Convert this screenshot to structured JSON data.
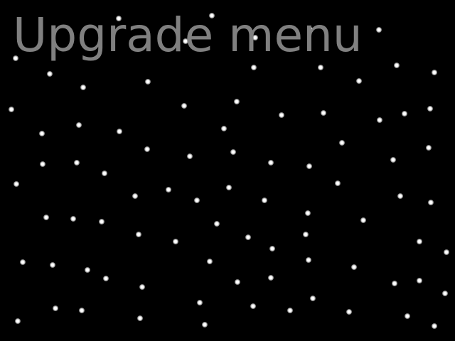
{
  "menu": {
    "title": "Upgrade menu",
    "title_color": "#808080"
  },
  "background": {
    "color": "#000000",
    "decoration": "starfield",
    "star_color": "#ffffff"
  }
}
